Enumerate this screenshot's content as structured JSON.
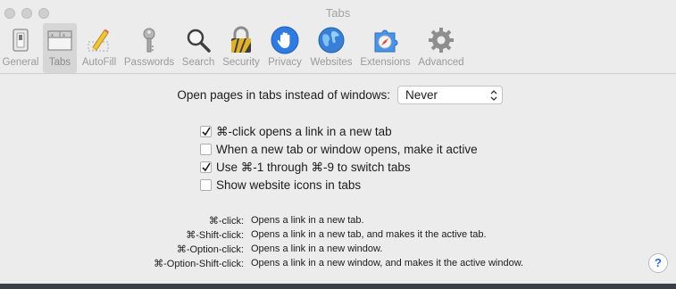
{
  "window": {
    "title": "Tabs"
  },
  "toolbar": {
    "items": [
      {
        "label": "General",
        "icon": "general-switch-icon"
      },
      {
        "label": "Tabs",
        "icon": "tabs-icon"
      },
      {
        "label": "AutoFill",
        "icon": "pencil-icon"
      },
      {
        "label": "Passwords",
        "icon": "key-icon"
      },
      {
        "label": "Search",
        "icon": "magnifier-icon"
      },
      {
        "label": "Security",
        "icon": "padlock-icon"
      },
      {
        "label": "Privacy",
        "icon": "hand-icon"
      },
      {
        "label": "Websites",
        "icon": "globe-icon"
      },
      {
        "label": "Extensions",
        "icon": "puzzle-compass-icon"
      },
      {
        "label": "Advanced",
        "icon": "gear-icon"
      }
    ],
    "selected": "Tabs"
  },
  "open_pages": {
    "label": "Open pages in tabs instead of windows:",
    "selected_value": "Never"
  },
  "options": [
    {
      "label": "⌘-click opens a link in a new tab",
      "checked": true
    },
    {
      "label": "When a new tab or window opens, make it active",
      "checked": false
    },
    {
      "label": "Use ⌘-1 through ⌘-9 to switch tabs",
      "checked": true
    },
    {
      "label": "Show website icons in tabs",
      "checked": false
    }
  ],
  "shortcuts": [
    {
      "key": "⌘-click:",
      "desc": "Opens a link in a new tab."
    },
    {
      "key": "⌘-Shift-click:",
      "desc": "Opens a link in a new tab, and makes it the active tab."
    },
    {
      "key": "⌘-Option-click:",
      "desc": "Opens a link in a new window."
    },
    {
      "key": "⌘-Option-Shift-click:",
      "desc": "Opens a link in a new window, and makes it the active window."
    }
  ],
  "help": {
    "label": "?"
  },
  "colors": {
    "accent": "#2a6bd6",
    "background": "#ececec",
    "check": "#1c1c1c"
  }
}
